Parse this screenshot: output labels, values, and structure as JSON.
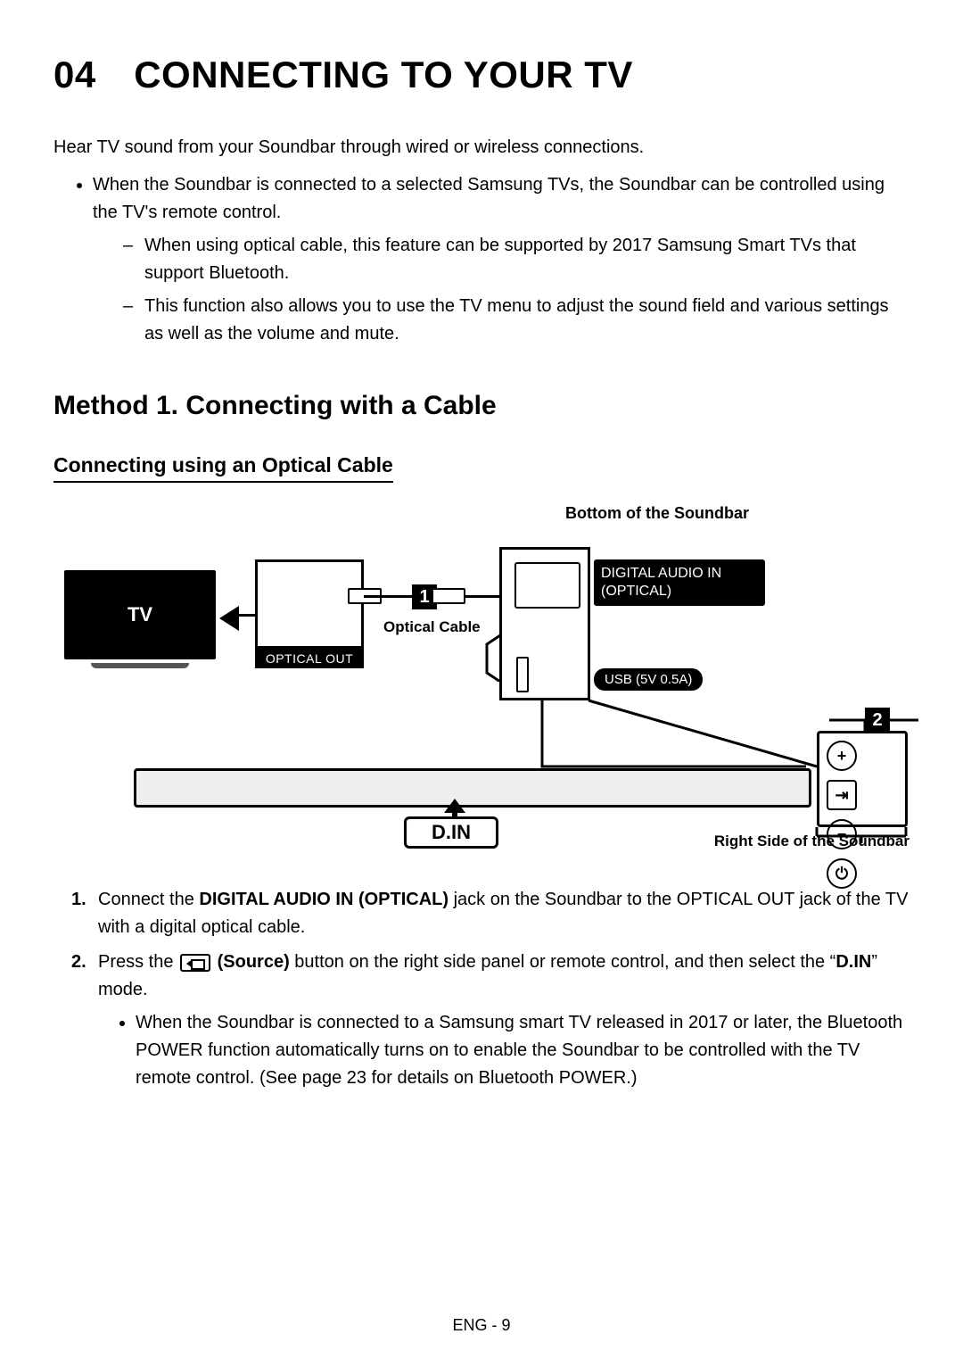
{
  "heading": "04 CONNECTING TO YOUR TV",
  "intro": "Hear TV sound from your Soundbar through wired or wireless connections.",
  "bullet1": "When the Soundbar is connected to a selected Samsung TVs, the Soundbar can be controlled using the TV's remote control.",
  "dash1": "When using optical cable, this feature can be supported by 2017 Samsung Smart TVs that support Bluetooth.",
  "dash2": "This function also allows you to use the TV menu to adjust the sound field and various settings as well as the volume and mute.",
  "method_heading": "Method 1. Connecting with a Cable",
  "sub_heading": "Connecting using an Optical Cable",
  "diagram": {
    "caption_top": "Bottom of the Soundbar",
    "tv_label": "TV",
    "optical_out": "OPTICAL OUT",
    "cable_caption": "Optical Cable",
    "dai_label": "DIGITAL AUDIO IN (OPTICAL)",
    "usb_label": "USB (5V 0.5A)",
    "din_label": "D.IN",
    "caption_right": "Right Side of the Soundbar",
    "step1": "1",
    "step2": "2",
    "side_buttons": {
      "plus": "+",
      "source": "⇥",
      "minus": "−",
      "power": "⏻"
    }
  },
  "steps": {
    "n1": "1.",
    "s1_a": "Connect the ",
    "s1_b": "DIGITAL AUDIO IN (OPTICAL)",
    "s1_c": " jack on the Soundbar to the OPTICAL OUT jack of the TV with a digital optical cable.",
    "n2": "2.",
    "s2_a": "Press the ",
    "s2_b": " (Source)",
    "s2_c": " button on the right side panel or remote control, and then select the “",
    "s2_d": "D.IN",
    "s2_e": "” mode.",
    "sub1": "When the Soundbar is connected to a Samsung smart TV released in 2017 or later, the Bluetooth POWER function automatically turns on to enable the Soundbar to be controlled with the TV remote control. (See page 23 for details on Bluetooth POWER.)"
  },
  "pagenum": "ENG - 9"
}
